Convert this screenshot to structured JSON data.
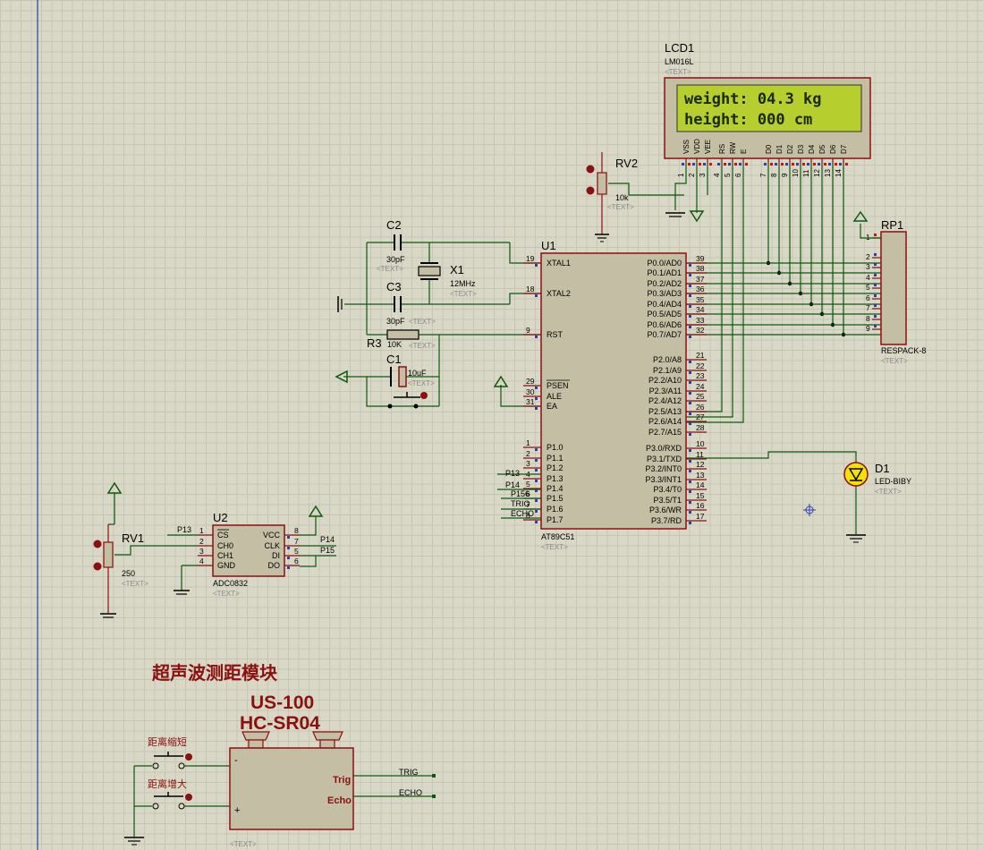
{
  "lcd": {
    "ref": "LCD1",
    "part": "LM016L",
    "text_placeholder": "<TEXT>",
    "line1": "weight: 04.3 kg",
    "line2": "height: 000  cm",
    "pins": [
      "VSS",
      "VDD",
      "VEE",
      "RS",
      "RW",
      "E",
      "D0",
      "D1",
      "D2",
      "D3",
      "D4",
      "D5",
      "D6",
      "D7"
    ],
    "pin_numbers": [
      "1",
      "2",
      "3",
      "4",
      "5",
      "6",
      "7",
      "8",
      "9",
      "10",
      "11",
      "12",
      "13",
      "14"
    ]
  },
  "rv2": {
    "ref": "RV2",
    "value": "10k",
    "text_placeholder": "<TEXT>"
  },
  "c2": {
    "ref": "C2",
    "value": "30pF",
    "text_placeholder": "<TEXT>"
  },
  "c3": {
    "ref": "C3",
    "value": "30pF",
    "text_placeholder": "<TEXT>"
  },
  "x1": {
    "ref": "X1",
    "value": "12MHz",
    "text_placeholder": "<TEXT>"
  },
  "r3": {
    "ref": "R3",
    "value": "10K",
    "text_placeholder": "<TEXT>"
  },
  "c1": {
    "ref": "C1",
    "value": "10uF",
    "text_placeholder": "<TEXT>"
  },
  "u1": {
    "ref": "U1",
    "part": "AT89C51",
    "text_placeholder": "<TEXT>",
    "left_pins": [
      {
        "num": "19",
        "name": "XTAL1"
      },
      {
        "num": "18",
        "name": "XTAL2"
      },
      {
        "num": "9",
        "name": "RST"
      },
      {
        "num": "29",
        "name": "PSEN"
      },
      {
        "num": "30",
        "name": "ALE"
      },
      {
        "num": "31",
        "name": "EA"
      },
      {
        "num": "1",
        "name": "P1.0"
      },
      {
        "num": "2",
        "name": "P1.1"
      },
      {
        "num": "3",
        "name": "P1.2"
      },
      {
        "num": "4",
        "name": "P1.3"
      },
      {
        "num": "5",
        "name": "P1.4"
      },
      {
        "num": "6",
        "name": "P1.5"
      },
      {
        "num": "7",
        "name": "P1.6"
      },
      {
        "num": "8",
        "name": "P1.7"
      }
    ],
    "right_pins": [
      {
        "num": "39",
        "name": "P0.0/AD0"
      },
      {
        "num": "38",
        "name": "P0.1/AD1"
      },
      {
        "num": "37",
        "name": "P0.2/AD2"
      },
      {
        "num": "36",
        "name": "P0.3/AD3"
      },
      {
        "num": "35",
        "name": "P0.4/AD4"
      },
      {
        "num": "34",
        "name": "P0.5/AD5"
      },
      {
        "num": "33",
        "name": "P0.6/AD6"
      },
      {
        "num": "32",
        "name": "P0.7/AD7"
      },
      {
        "num": "21",
        "name": "P2.0/A8"
      },
      {
        "num": "22",
        "name": "P2.1/A9"
      },
      {
        "num": "23",
        "name": "P2.2/A10"
      },
      {
        "num": "24",
        "name": "P2.3/A11"
      },
      {
        "num": "25",
        "name": "P2.4/A12"
      },
      {
        "num": "26",
        "name": "P2.5/A13"
      },
      {
        "num": "27",
        "name": "P2.6/A14"
      },
      {
        "num": "28",
        "name": "P2.7/A15"
      },
      {
        "num": "10",
        "name": "P3.0/RXD"
      },
      {
        "num": "11",
        "name": "P3.1/TXD"
      },
      {
        "num": "12",
        "name": "P3.2/INT0"
      },
      {
        "num": "13",
        "name": "P3.3/INT1"
      },
      {
        "num": "14",
        "name": "P3.4/T0"
      },
      {
        "num": "15",
        "name": "P3.5/T1"
      },
      {
        "num": "16",
        "name": "P3.6/WR"
      },
      {
        "num": "17",
        "name": "P3.7/RD"
      }
    ],
    "net_labels": [
      "P13",
      "P14",
      "P156",
      "TRIG",
      "ECHO"
    ]
  },
  "rp1": {
    "ref": "RP1",
    "part": "RESPACK-8",
    "text_placeholder": "<TEXT>",
    "pins": [
      "1",
      "2",
      "3",
      "4",
      "5",
      "6",
      "7",
      "8",
      "9"
    ]
  },
  "d1": {
    "ref": "D1",
    "part": "LED-BIBY",
    "text_placeholder": "<TEXT>"
  },
  "rv1": {
    "ref": "RV1",
    "value": "250",
    "text_placeholder": "<TEXT>"
  },
  "u2": {
    "ref": "U2",
    "part": "ADC0832",
    "text_placeholder": "<TEXT>",
    "left_pins": [
      {
        "num": "1",
        "name": "CS"
      },
      {
        "num": "2",
        "name": "CH0"
      },
      {
        "num": "3",
        "name": "CH1"
      },
      {
        "num": "4",
        "name": "GND"
      }
    ],
    "right_pins": [
      {
        "num": "8",
        "name": "VCC"
      },
      {
        "num": "7",
        "name": "CLK"
      },
      {
        "num": "5",
        "name": "DI"
      },
      {
        "num": "6",
        "name": "DO"
      }
    ],
    "net_labels": [
      "P13",
      "P14",
      "P15"
    ]
  },
  "ultrasonic": {
    "title": "超声波测距模块",
    "model1": "US-100",
    "model2": "HC-SR04",
    "btn1": "距离缩短",
    "btn2": "距离增大",
    "minus": "-",
    "plus": "+",
    "trig": "Trig",
    "echo": "Echo",
    "net_trig": "TRIG",
    "net_echo": "ECHO",
    "text_placeholder": "<TEXT>"
  },
  "colors": {
    "wire": "#0d5a0d",
    "outline": "#8b1010",
    "body": "#c4bfa4",
    "lcd": "#b7cf2e"
  }
}
